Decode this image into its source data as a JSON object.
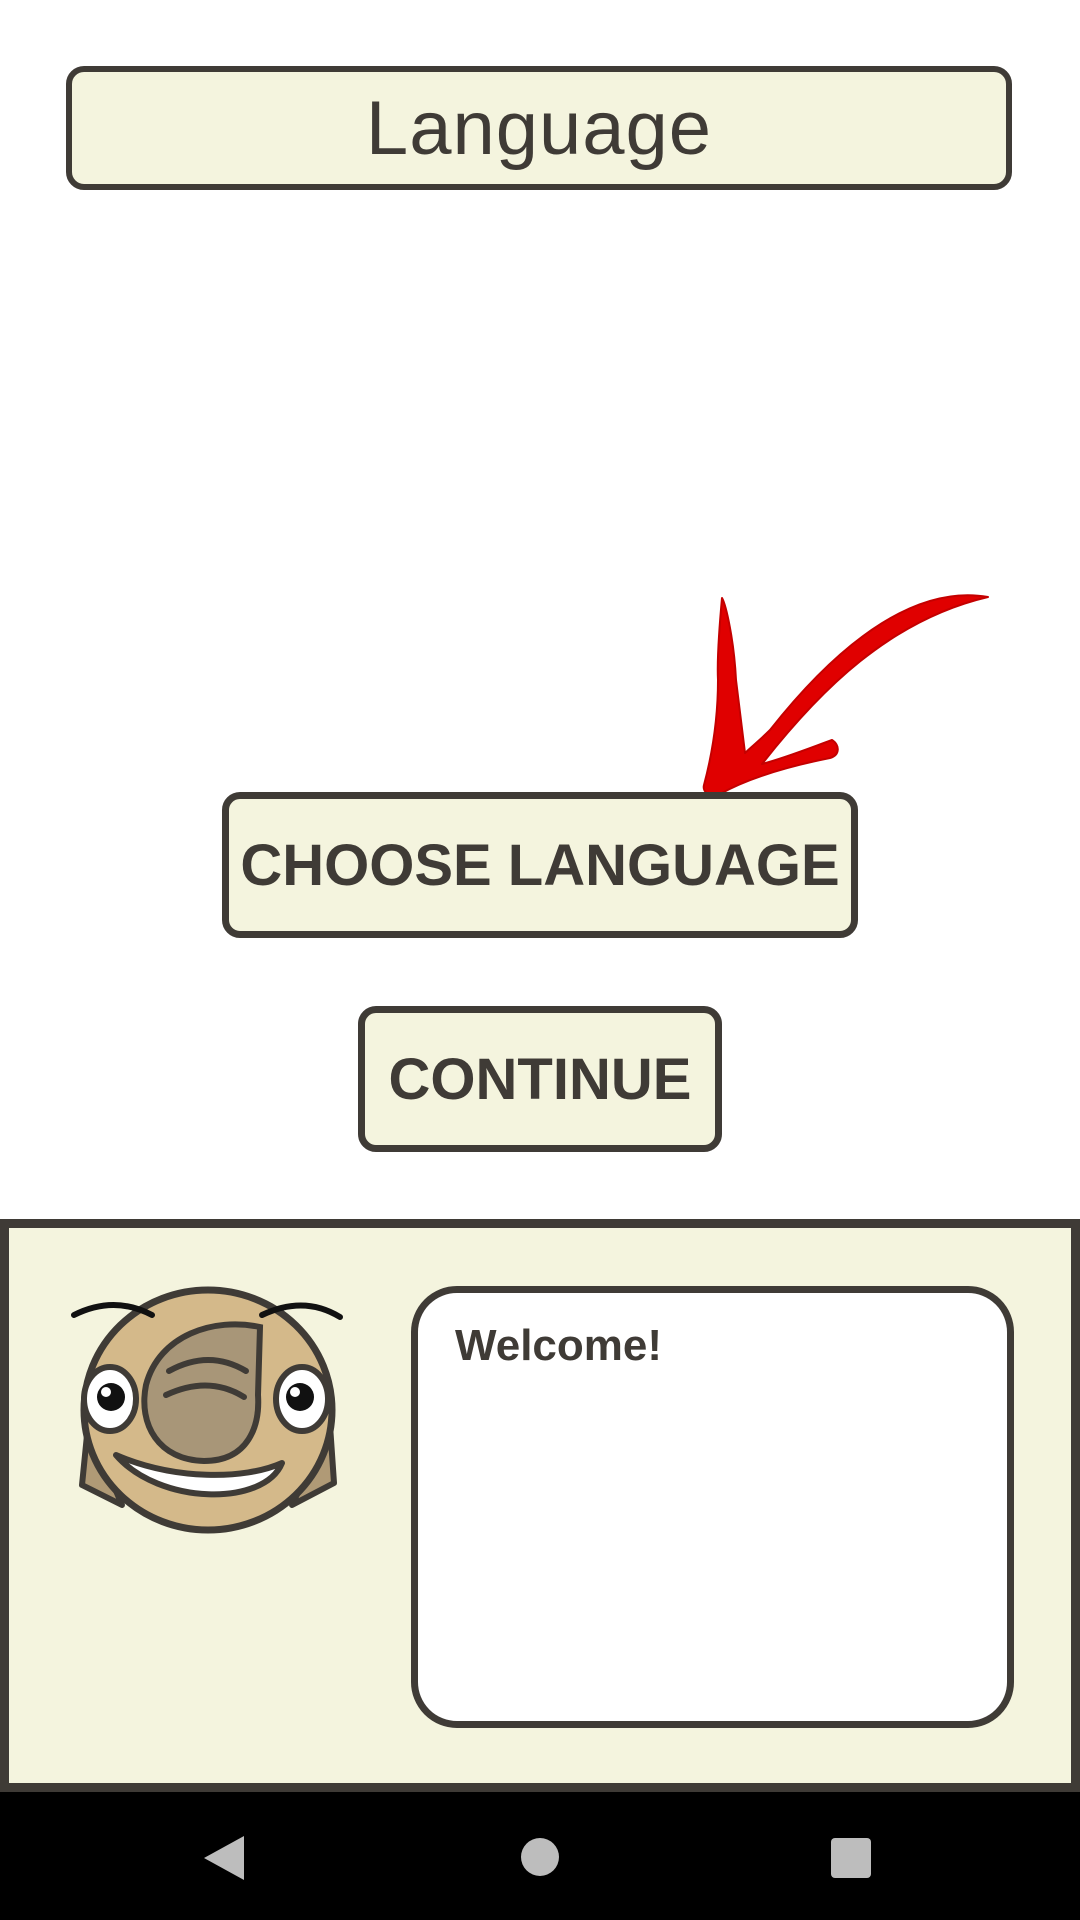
{
  "header": {
    "title": "Language"
  },
  "buttons": {
    "choose_language": "CHOOSE LANGUAGE",
    "continue": "CONTINUE"
  },
  "dialog": {
    "message": "Welcome!"
  },
  "icons": {
    "hint": "red-arrow-icon",
    "avatar": "mascot-face-icon",
    "back": "back-icon",
    "home": "home-icon",
    "recents": "recents-icon"
  },
  "colors": {
    "panel_background": "#f4f4de",
    "border": "#3f3b36",
    "arrow": "#e00000",
    "navbar": "#000000"
  }
}
